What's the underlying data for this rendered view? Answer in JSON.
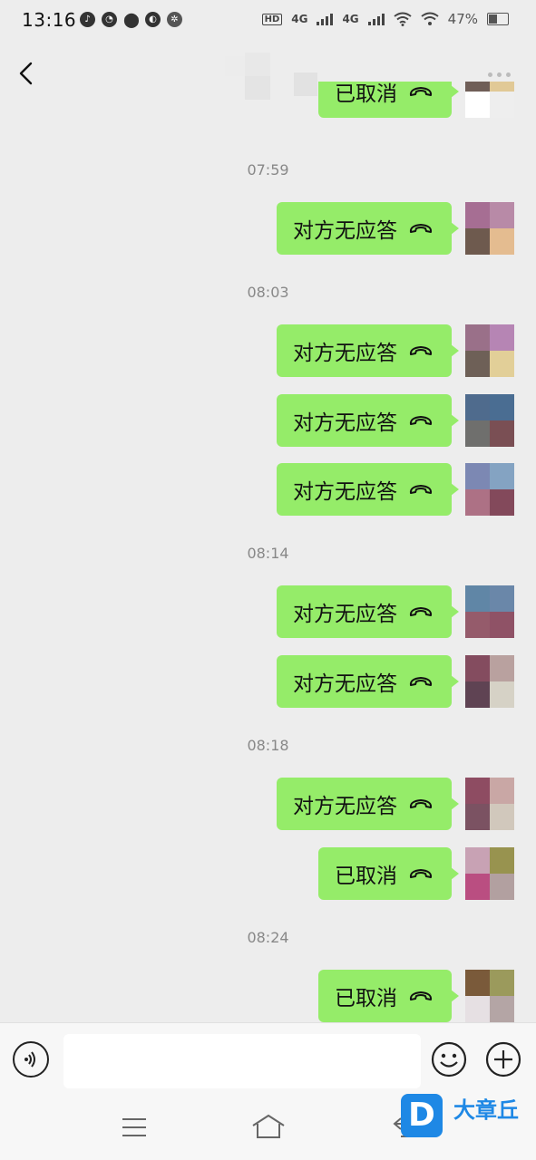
{
  "status_bar": {
    "time": "13:16",
    "network_1": "4G",
    "network_2": "4G",
    "hd": "HD",
    "battery": "47%"
  },
  "header": {
    "back_icon": "chevron-left-icon",
    "more_icon": "more-dots-icon"
  },
  "messages": [
    {
      "kind": "msg",
      "text": "已取消",
      "avatar": [
        "#6f5e57",
        "#e1c996",
        "#ffffff",
        "#eeeeee"
      ]
    },
    {
      "kind": "ts",
      "text": "07:59"
    },
    {
      "kind": "msg",
      "text": "对方无应答",
      "avatar": [
        "#a66e93",
        "#b88aa7",
        "#6e5a4e",
        "#e4bc90"
      ]
    },
    {
      "kind": "ts",
      "text": "08:03"
    },
    {
      "kind": "msg",
      "text": "对方无应答",
      "avatar": [
        "#9a7089",
        "#b685b4",
        "#6e6057",
        "#e2cf98"
      ]
    },
    {
      "kind": "msg",
      "text": "对方无应答",
      "avatar": [
        "#4f6b8d",
        "#4a6d92",
        "#6f6f6d",
        "#7a4f54"
      ]
    },
    {
      "kind": "msg",
      "text": "对方无应答",
      "avatar": [
        "#7c88b3",
        "#84a3c2",
        "#ad7185",
        "#83495b"
      ]
    },
    {
      "kind": "ts",
      "text": "08:14"
    },
    {
      "kind": "msg",
      "text": "对方无应答",
      "avatar": [
        "#6086a6",
        "#6a87a9",
        "#955b6b",
        "#8f5266"
      ]
    },
    {
      "kind": "msg",
      "text": "对方无应答",
      "avatar": [
        "#844c5f",
        "#b9a19f",
        "#5f4353",
        "#d6d2c6"
      ]
    },
    {
      "kind": "ts",
      "text": "08:18"
    },
    {
      "kind": "msg",
      "text": "对方无应答",
      "avatar": [
        "#8e4c62",
        "#c9a7a5",
        "#7b5262",
        "#d1c8bc"
      ]
    },
    {
      "kind": "msg",
      "text": "已取消",
      "avatar": [
        "#c8a2b4",
        "#98934f",
        "#ba4e81",
        "#b2a0a0"
      ]
    },
    {
      "kind": "ts",
      "text": "08:24"
    },
    {
      "kind": "msg",
      "text": "已取消",
      "avatar": [
        "#7a5a3a",
        "#9b9a5c",
        "#e6e0e3",
        "#b4a5a5"
      ]
    }
  ],
  "input_bar": {
    "voice_icon": "voice-icon",
    "text_value": "",
    "emoji_icon": "emoji-icon",
    "plus_icon": "plus-icon"
  },
  "nav_bar": {
    "menu_icon": "menu-icon",
    "home_icon": "home-icon",
    "back_icon": "back-icon"
  },
  "watermark": {
    "letter": "D",
    "name": "大章丘"
  },
  "colors": {
    "bubble": "#95ec69",
    "background": "#ededed",
    "brand": "#1e88e5"
  }
}
